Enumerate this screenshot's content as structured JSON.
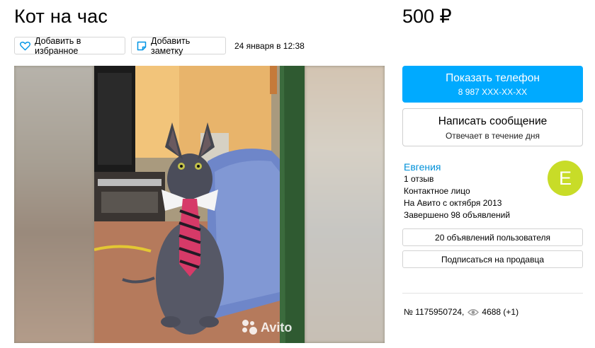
{
  "listing": {
    "title": "Кот на час",
    "price": "500 ₽",
    "date": "24 января в 12:38",
    "number": "№ 1175950724,",
    "views": "4688 (+1)"
  },
  "actions": {
    "favorite_label": "Добавить в избранное",
    "note_label": "Добавить заметку"
  },
  "contact": {
    "show_phone_label": "Показать телефон",
    "phone_masked": "8 987 XXX-XX-XX",
    "write_label": "Написать сообщение",
    "write_sub": "Отвечает в течение дня"
  },
  "seller": {
    "name": "Евгения",
    "avatar_letter": "Е",
    "reviews": "1 отзыв",
    "type": "Контактное лицо",
    "since": "На Авито с октября 2013",
    "completed": "Завершено 98 объявлений",
    "ads_button": "20 объявлений пользователя",
    "subscribe_button": "Подписаться на продавца"
  },
  "gallery": {
    "watermark": "Avito"
  },
  "colors": {
    "accent": "#00aaff",
    "link": "#0091d9",
    "avatar": "#c8dc28"
  },
  "icons": [
    "heart-icon",
    "note-icon",
    "eye-icon",
    "avito-logo-icon"
  ]
}
